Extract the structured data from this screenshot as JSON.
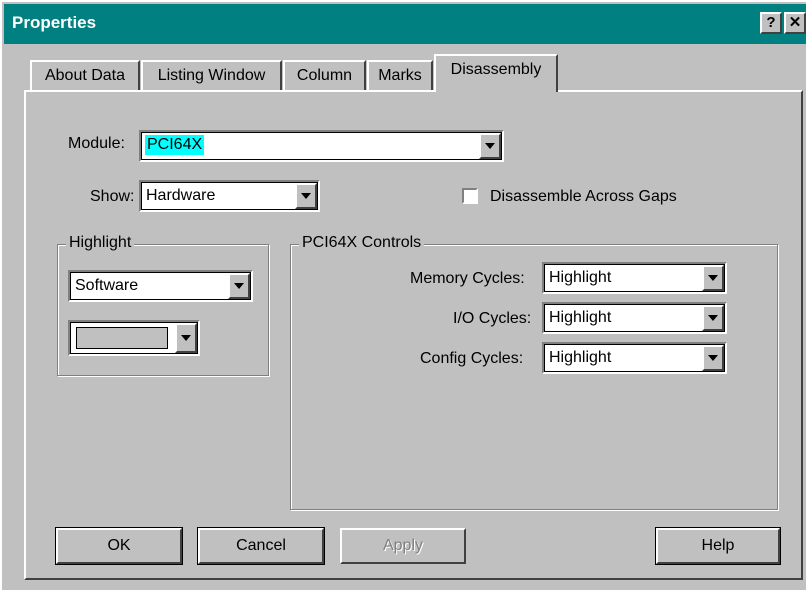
{
  "window": {
    "title": "Properties",
    "help_button": "?",
    "close_button": "✕"
  },
  "tabs": [
    {
      "label": "About Data"
    },
    {
      "label": "Listing Window"
    },
    {
      "label": "Column"
    },
    {
      "label": "Marks"
    },
    {
      "label": "Disassembly"
    }
  ],
  "active_tab": "Disassembly",
  "disassembly": {
    "module_label": "Module:",
    "module_value": "PCI64X",
    "show_label": "Show:",
    "show_value": "Hardware",
    "disassemble_across_gaps_label": "Disassemble Across Gaps",
    "disassemble_across_gaps_checked": false,
    "highlight_group": {
      "title": "Highlight",
      "type_value": "Software",
      "color_value": ""
    },
    "controls_group": {
      "title": "PCI64X Controls",
      "memory_cycles_label": "Memory Cycles:",
      "memory_cycles_value": "Highlight",
      "io_cycles_label": "I/O Cycles:",
      "io_cycles_value": "Highlight",
      "config_cycles_label": "Config Cycles:",
      "config_cycles_value": "Highlight"
    }
  },
  "buttons": {
    "ok": "OK",
    "cancel": "Cancel",
    "apply": "Apply",
    "help": "Help"
  },
  "colors": {
    "titlebar": "#008080",
    "face": "#c0c0c0",
    "selection": "#00ffff"
  }
}
